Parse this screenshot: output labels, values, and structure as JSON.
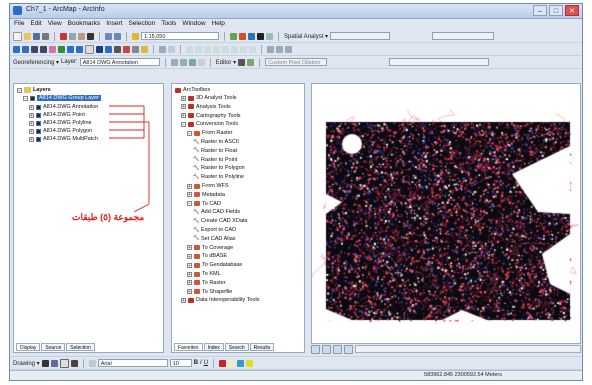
{
  "window": {
    "title": "Ch7_1 - ArcMap - ArcInfo"
  },
  "menu": [
    "File",
    "Edit",
    "View",
    "Bookmarks",
    "Insert",
    "Selection",
    "Tools",
    "Window",
    "Help"
  ],
  "standard_toolbar": {
    "scale_value": "1:15,050",
    "spatial_analyst_label": "Spatial Analyst ▾"
  },
  "layout_toolbar": {
    "georef_label": "Georeferencing ▾",
    "layer_label": "Layer:",
    "layer_value": "A814 DWG Annotation",
    "editor_label": "Editor ▾",
    "tolerance_value": "Custom Pixel Dilation"
  },
  "toc": {
    "root_label": "Layers",
    "group_label": "A814 DWG Group Layer",
    "layers": [
      "A814.DWG Annotation",
      "A814.DWG Point",
      "A814.DWG Polyline",
      "A814.DWG Polygon",
      "A814.DWG MultiPatch"
    ],
    "tabs": [
      "Display",
      "Source",
      "Selection"
    ]
  },
  "annotation": {
    "text": "مجموعة (٥) طبقات",
    "color": "#e0201c"
  },
  "arctoolbox": {
    "title": "ArcToolbox",
    "items": [
      {
        "label": "3D Analyst Tools",
        "kind": "toolbox",
        "indent": 1,
        "expanded": false
      },
      {
        "label": "Analysis Tools",
        "kind": "toolbox",
        "indent": 1,
        "expanded": false
      },
      {
        "label": "Cartography Tools",
        "kind": "toolbox",
        "indent": 1,
        "expanded": false
      },
      {
        "label": "Conversion Tools",
        "kind": "toolbox",
        "indent": 1,
        "expanded": true
      },
      {
        "label": "From Raster",
        "kind": "toolset",
        "indent": 2,
        "expanded": true
      },
      {
        "label": "Raster to ASCII",
        "kind": "tool",
        "indent": 3
      },
      {
        "label": "Raster to Float",
        "kind": "tool",
        "indent": 3
      },
      {
        "label": "Raster to Point",
        "kind": "tool",
        "indent": 3
      },
      {
        "label": "Raster to Polygon",
        "kind": "tool",
        "indent": 3
      },
      {
        "label": "Raster to Polyline",
        "kind": "tool",
        "indent": 3
      },
      {
        "label": "From WFS",
        "kind": "toolset",
        "indent": 2,
        "expanded": false
      },
      {
        "label": "Metadata",
        "kind": "toolset",
        "indent": 2,
        "expanded": false
      },
      {
        "label": "To CAD",
        "kind": "toolset",
        "indent": 2,
        "expanded": true
      },
      {
        "label": "Add CAD Fields",
        "kind": "tool",
        "indent": 3
      },
      {
        "label": "Create CAD XData",
        "kind": "tool",
        "indent": 3
      },
      {
        "label": "Export to CAD",
        "kind": "tool",
        "indent": 3
      },
      {
        "label": "Set CAD Alias",
        "kind": "tool",
        "indent": 3
      },
      {
        "label": "To Coverage",
        "kind": "toolset",
        "indent": 2,
        "expanded": false
      },
      {
        "label": "To dBASE",
        "kind": "toolset",
        "indent": 2,
        "expanded": false
      },
      {
        "label": "To Geodatabase",
        "kind": "toolset",
        "indent": 2,
        "expanded": false
      },
      {
        "label": "To KML",
        "kind": "toolset",
        "indent": 2,
        "expanded": false
      },
      {
        "label": "To Raster",
        "kind": "toolset",
        "indent": 2,
        "expanded": false
      },
      {
        "label": "To Shapefile",
        "kind": "toolset",
        "indent": 2,
        "expanded": false
      },
      {
        "label": "Data Interoperability Tools",
        "kind": "toolbox",
        "indent": 1,
        "expanded": false
      }
    ],
    "tabs": [
      "Favorites",
      "Index",
      "Search",
      "Results"
    ]
  },
  "draw_toolbar": {
    "drawing_label": "Drawing ▾",
    "font_value": "Arial",
    "size_value": "10",
    "bold": "B",
    "italic": "I",
    "underline": "U"
  },
  "status_bar": {
    "coordinates": "583962.845 2300592.54 Meters"
  }
}
